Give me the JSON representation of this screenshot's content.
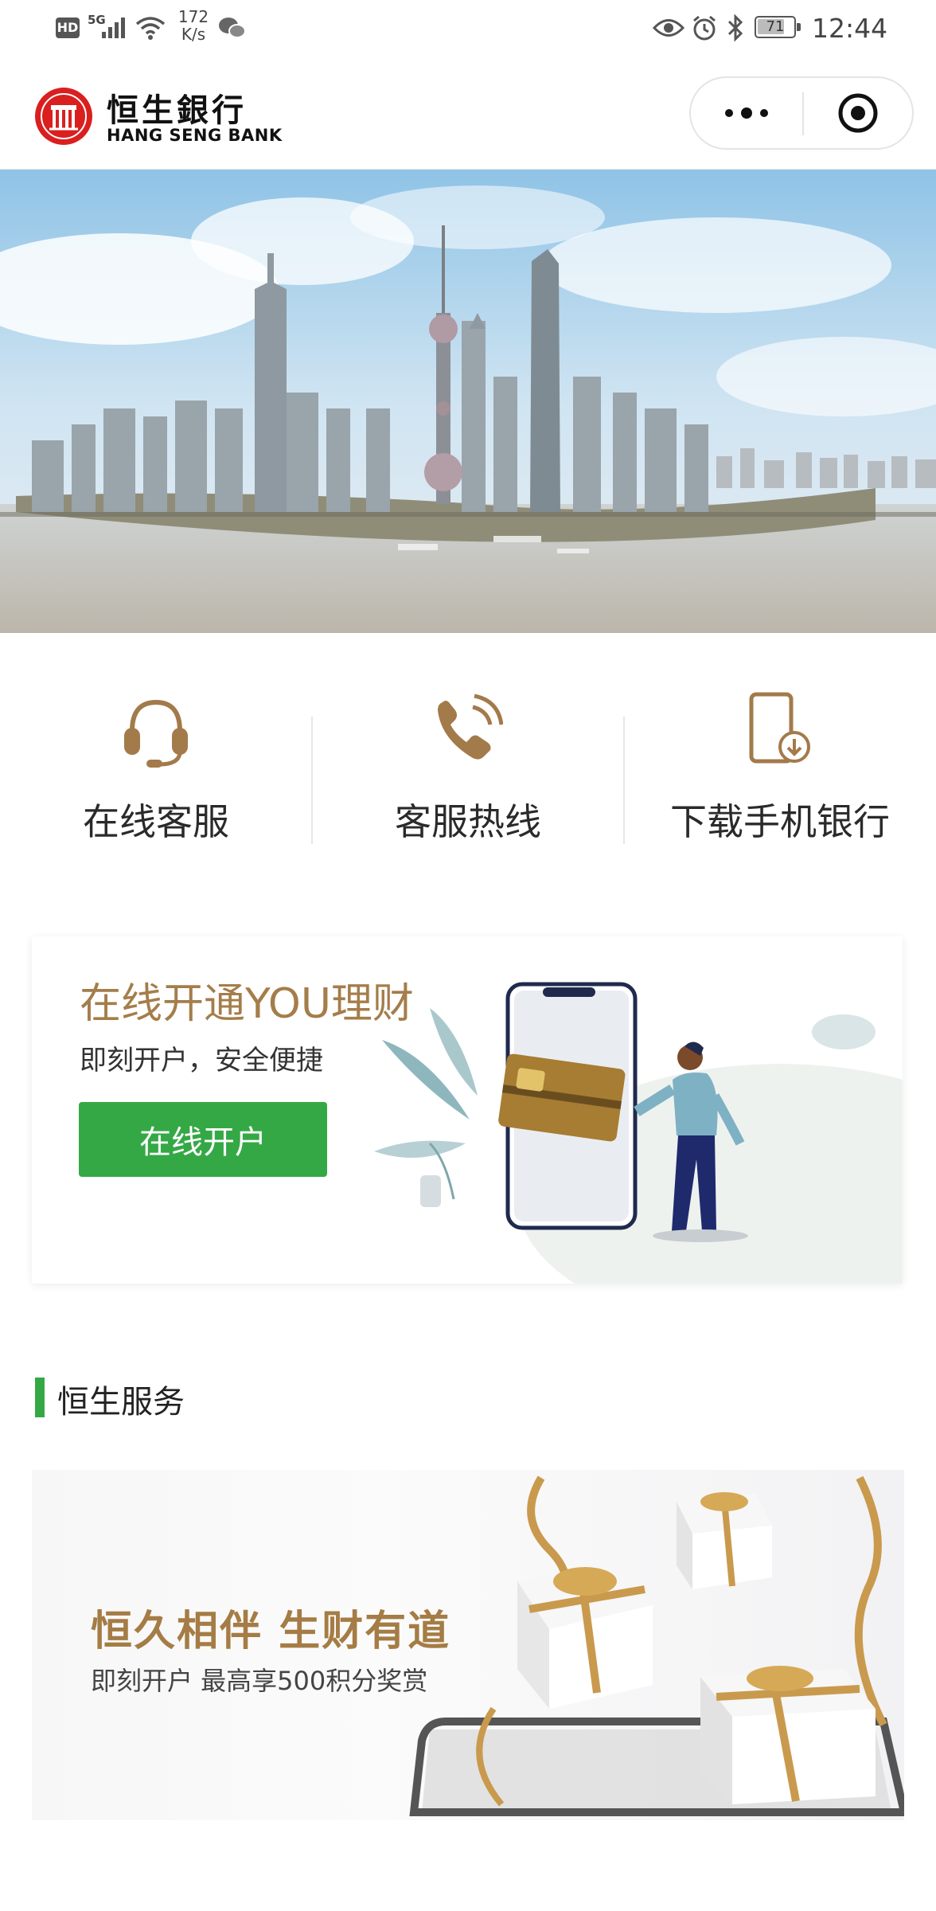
{
  "status_bar": {
    "hd": "HD",
    "network": "5G",
    "speed_value": "172",
    "speed_unit": "K/s",
    "battery": "71",
    "time": "12:44"
  },
  "header": {
    "logo_cn": "恒生銀行",
    "logo_en": "HANG SENG BANK",
    "more_icon": "ellipsis-icon",
    "close_icon": "target-circle-icon"
  },
  "quick_actions": [
    {
      "label": "在线客服",
      "icon": "headset-icon"
    },
    {
      "label": "客服热线",
      "icon": "phone-icon"
    },
    {
      "label": "下载手机银行",
      "icon": "mobile-download-icon"
    }
  ],
  "promo": {
    "title": "在线开通YOU理财",
    "subtitle": "即刻开户，安全便捷",
    "button": "在线开户"
  },
  "section": {
    "title": "恒生服务"
  },
  "service_banner": {
    "title": "恒久相伴 生财有道",
    "subtitle": "即刻开户 最高享500积分奖赏"
  },
  "colors": {
    "accent_green": "#35a846",
    "gold": "#a47d4a",
    "brand_red": "#d9201f"
  }
}
